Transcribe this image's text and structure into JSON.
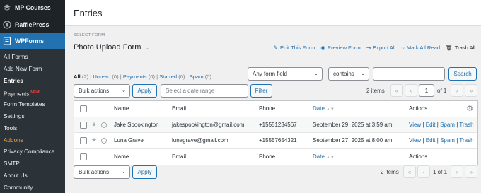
{
  "sidebar": {
    "top_items": [
      {
        "label": "MP Courses",
        "icon": "mortarboard-icon"
      },
      {
        "label": "RafflePress",
        "icon": "raffle-icon"
      }
    ],
    "active": {
      "label": "WPForms",
      "icon": "wpforms-icon"
    },
    "sub_items": [
      {
        "label": "All Forms"
      },
      {
        "label": "Add New Form"
      },
      {
        "label": "Entries",
        "current": true
      },
      {
        "label": "Payments",
        "badge": "NEW!"
      },
      {
        "label": "Form Templates"
      },
      {
        "label": "Settings"
      },
      {
        "label": "Tools"
      },
      {
        "label": "Addons",
        "accent": "#f0a14b"
      },
      {
        "label": "Privacy Compliance"
      },
      {
        "label": "SMTP"
      },
      {
        "label": "About Us"
      },
      {
        "label": "Community"
      }
    ]
  },
  "header": {
    "title": "Entries"
  },
  "form_selector": {
    "label": "SELECT FORM",
    "value": "Photo Upload Form"
  },
  "form_actions": {
    "edit": "Edit This Form",
    "preview": "Preview Form",
    "export": "Export All",
    "mark_read": "Mark All Read",
    "trash": "Trash All"
  },
  "status_filters": {
    "all": "All",
    "all_count": "(2)",
    "unread": "Unread",
    "unread_count": "(0)",
    "payments": "Payments",
    "payments_count": "(0)",
    "starred": "Starred",
    "starred_count": "(0)",
    "spam": "Spam",
    "spam_count": "(0)"
  },
  "search": {
    "field_select": "Any form field",
    "operator_select": "contains",
    "value": "",
    "button": "Search"
  },
  "top_controls": {
    "bulk_actions": "Bulk actions",
    "apply": "Apply",
    "date_placeholder": "Select a date range",
    "filter": "Filter",
    "items": "2 items",
    "page": "1",
    "of": "of 1"
  },
  "table": {
    "columns": [
      "Name",
      "Email",
      "Phone",
      "Date",
      "Actions"
    ],
    "rows": [
      {
        "name": "Jake Spookington",
        "email": "jakespookington@gmail.com",
        "phone": "+15551234567",
        "date": "September 29, 2025 at 3:59 am"
      },
      {
        "name": "Luna Grave",
        "email": "lunagrave@gmail.com",
        "phone": "+15557654321",
        "date": "September 27, 2025 at 8:00 am"
      }
    ],
    "row_actions": {
      "view": "View",
      "edit": "Edit",
      "spam": "Spam",
      "trash": "Trash"
    }
  },
  "bottom_controls": {
    "bulk_actions": "Bulk actions",
    "apply": "Apply",
    "items": "2 items",
    "page_text": "1 of 1"
  },
  "colors": {
    "accent": "#2271b1",
    "sidebar_bg": "#1d2327",
    "addons": "#f0a14b"
  }
}
